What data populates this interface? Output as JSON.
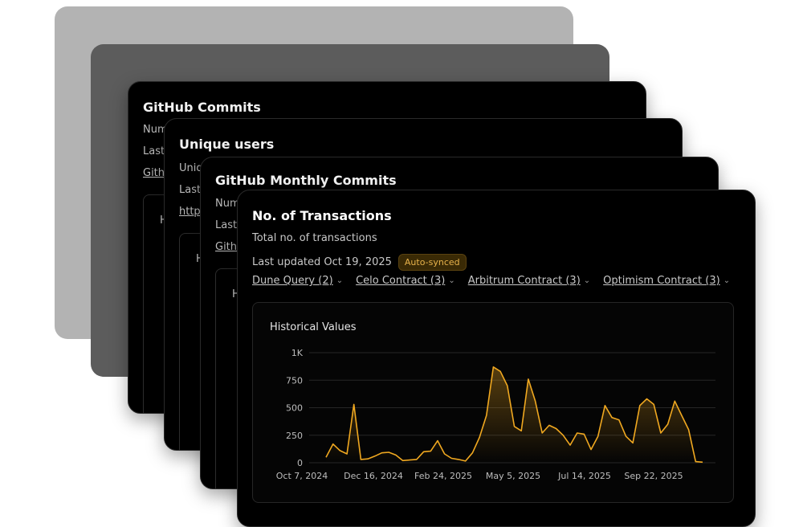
{
  "back_cards": [
    {
      "title": "GitHub Commits",
      "line1": "Num",
      "line2": "Last",
      "link": "Githu",
      "inner": "H"
    },
    {
      "title": "Unique users",
      "line1": "Uniq",
      "line2": "Last",
      "link": "http",
      "inner": "H"
    },
    {
      "title": "GitHub Monthly Commits",
      "line1": "Num",
      "line2": "Last",
      "link": "Githu",
      "inner": "H"
    }
  ],
  "front": {
    "title": "No. of Transactions",
    "subtitle": "Total no. of transactions",
    "updated": "Last updated Oct 19, 2025",
    "badge": "Auto-synced",
    "filters": [
      "Dune Query (2)",
      "Celo Contract (3)",
      "Arbitrum Contract (3)",
      "Optimism Contract (3)"
    ],
    "chart_heading": "Historical Values"
  },
  "colors": {
    "line": "#f0a820",
    "background": "#000000",
    "badge_text": "#e8b34b"
  },
  "chart_data": {
    "type": "area",
    "title": "Historical Values",
    "y_ticks": [
      "0",
      "250",
      "500",
      "750",
      "1K"
    ],
    "ylim": [
      0,
      1000
    ],
    "x_tick_labels": [
      "Oct 7, 2024",
      "Dec 16, 2024",
      "Feb 24, 2025",
      "May 5, 2025",
      "Jul 14, 2025",
      "Sep 22, 2025"
    ],
    "grid": true,
    "series": [
      {
        "values": [
          50,
          170,
          110,
          80,
          530,
          30,
          35,
          60,
          90,
          95,
          70,
          20,
          25,
          30,
          100,
          105,
          200,
          80,
          40,
          30,
          15,
          90,
          230,
          430,
          870,
          830,
          700,
          330,
          290,
          760,
          560,
          270,
          340,
          310,
          250,
          160,
          270,
          260,
          120,
          240,
          520,
          410,
          390,
          240,
          180,
          520,
          580,
          530,
          270,
          350,
          560,
          430,
          300,
          10,
          5
        ]
      }
    ]
  }
}
